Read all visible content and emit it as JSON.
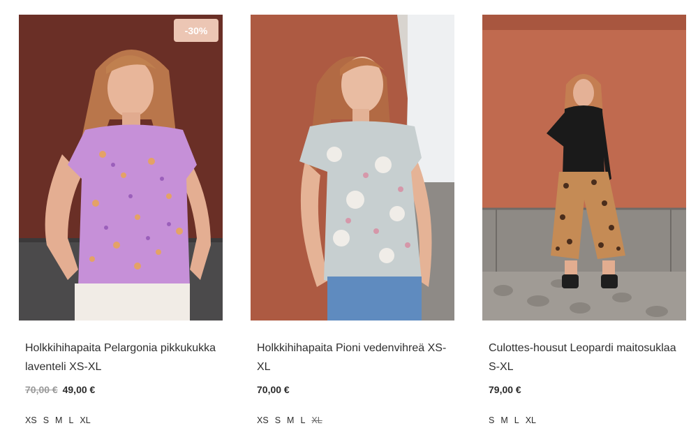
{
  "products": [
    {
      "title": "Holkkihihapaita Pelargonia pikkukukka laventeli XS-XL",
      "badge": "-30%",
      "old_price": "70,00 €",
      "price": "49,00 €",
      "sizes": [
        "XS",
        "S",
        "M",
        "L",
        "XL"
      ]
    },
    {
      "title": "Holkkihihapaita Pioni vedenvihreä XS-XL",
      "price": "70,00 €",
      "sizes": [
        "XS",
        "S",
        "M",
        "L"
      ],
      "sizes_unavailable": [
        "XL"
      ]
    },
    {
      "title": "Culottes-housut Leopardi maitosuklaa S-XL",
      "price": "79,00 €",
      "sizes": [
        "S",
        "M",
        "L",
        "XL"
      ]
    }
  ]
}
